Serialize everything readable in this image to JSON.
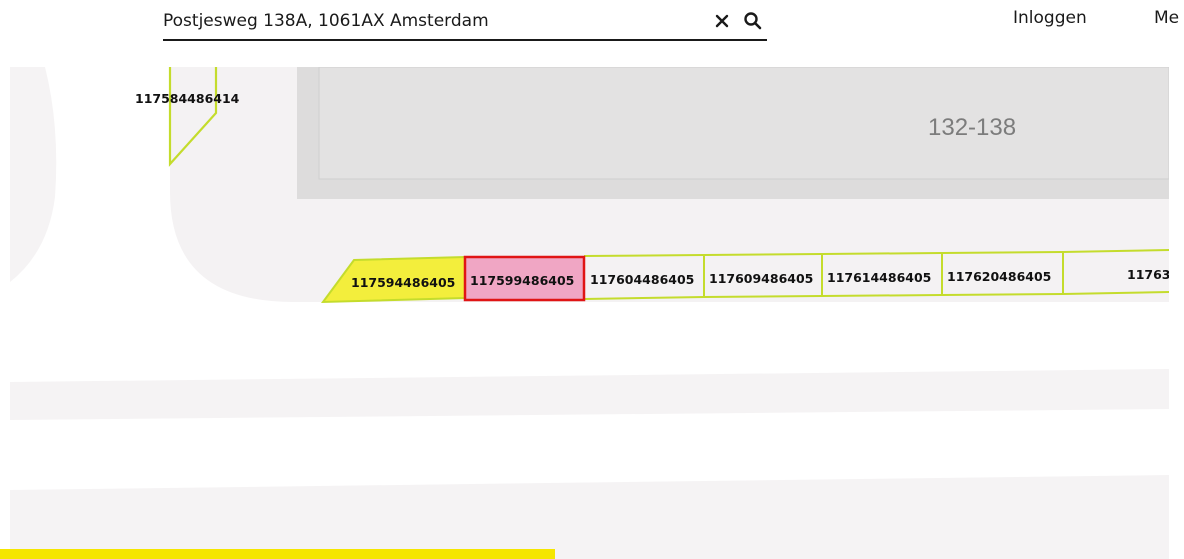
{
  "search": {
    "value": "Postjesweg 138A, 1061AX Amsterdam",
    "placeholder": ""
  },
  "nav": {
    "login": "Inloggen",
    "menu": "Me"
  },
  "map": {
    "building_number": "132-138",
    "corner_parcel": "117584486414",
    "parcels": [
      {
        "id": "117594486405",
        "state": "highlighted"
      },
      {
        "id": "117599486405",
        "state": "selected"
      },
      {
        "id": "117604486405",
        "state": "default"
      },
      {
        "id": "117609486405",
        "state": "default"
      },
      {
        "id": "117614486405",
        "state": "default"
      },
      {
        "id": "117620486405",
        "state": "default"
      },
      {
        "id": "11763",
        "state": "default"
      }
    ]
  },
  "colors": {
    "parcel_outline": "#c4dc2c",
    "highlight_fill": "#f3ee3c",
    "selected_fill": "#f0a6c4",
    "selected_border": "#e01515",
    "building_fill": "#e3e2e2",
    "street_fill": "#f5f3f4",
    "accent_bar": "#f5e600"
  },
  "icons": {
    "clear": "close-icon",
    "search": "search-icon"
  }
}
